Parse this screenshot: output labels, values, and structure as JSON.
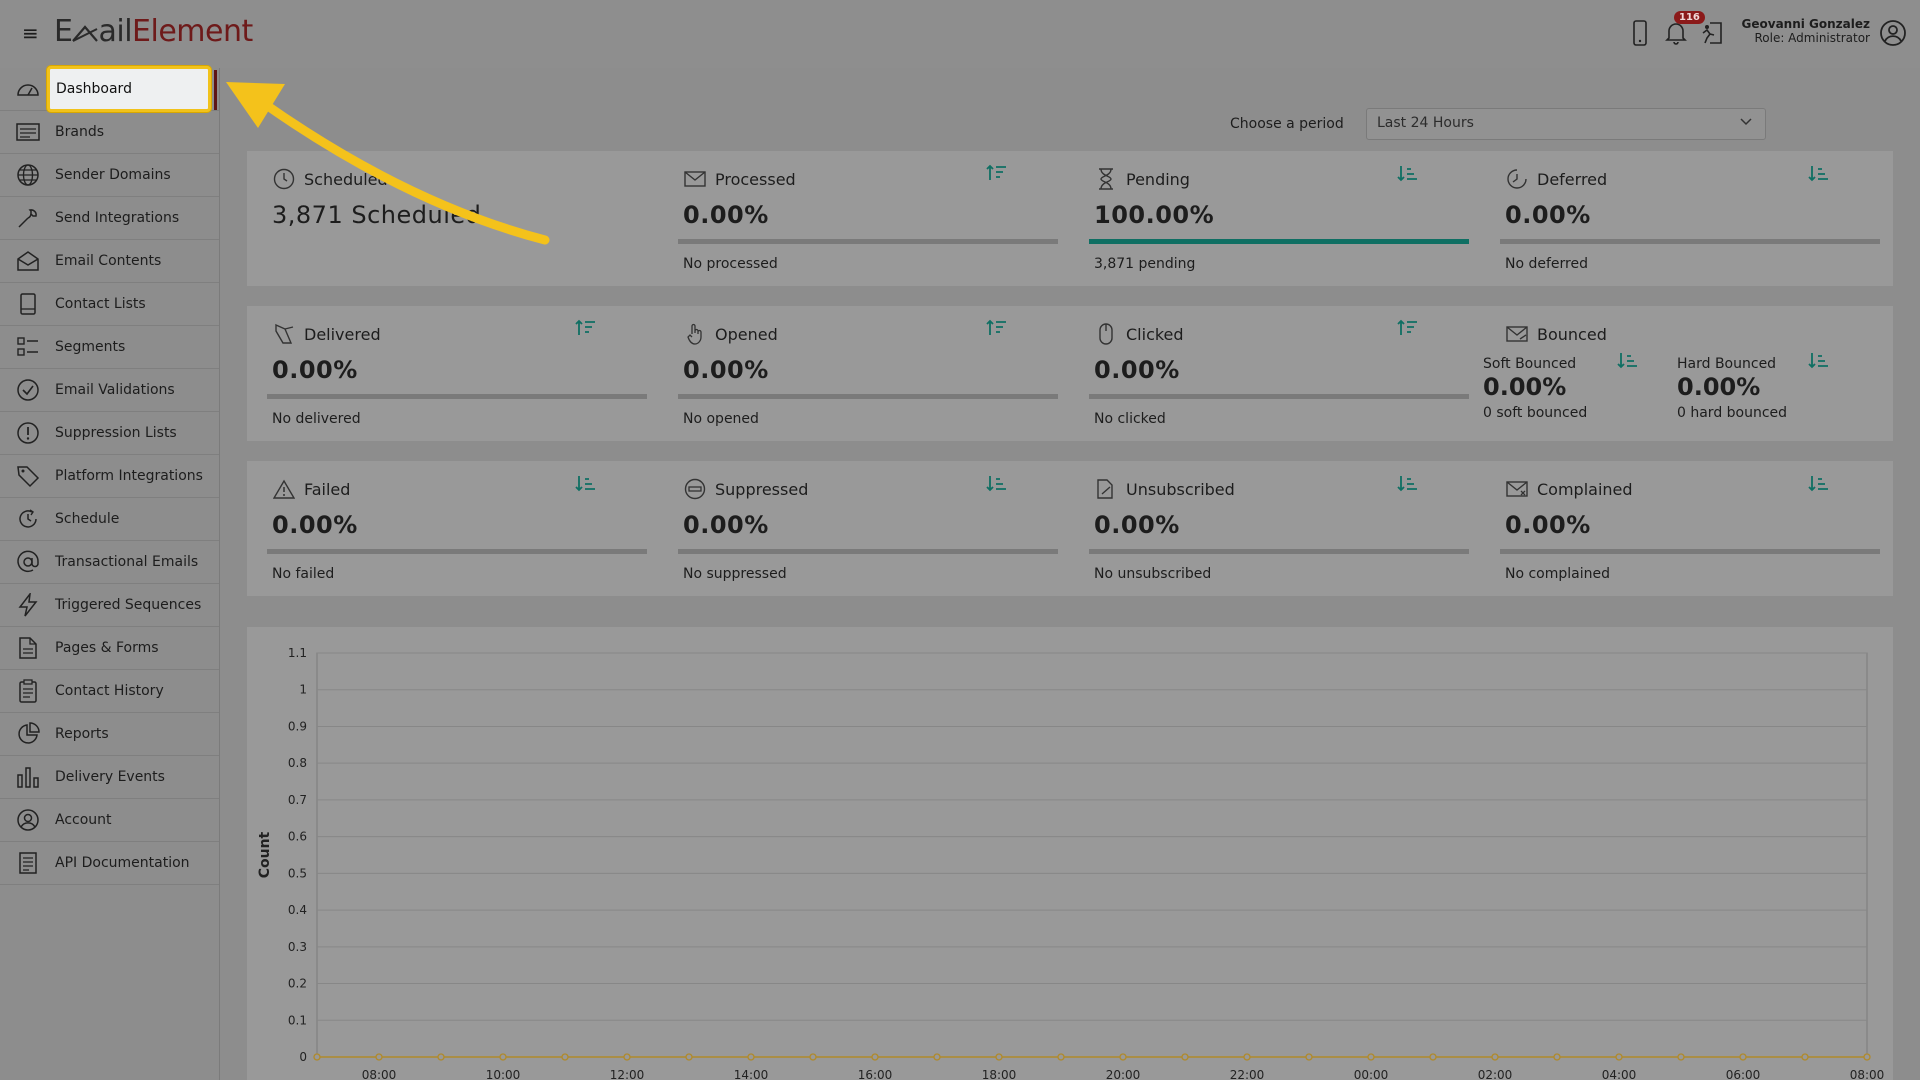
{
  "header": {
    "logo_part1": "E",
    "logo_part2": "ail",
    "logo_part3": "Element",
    "notification_count": "116",
    "user_name": "Geovanni Gonzalez",
    "user_role": "Role: Administrator"
  },
  "sidebar": {
    "items": [
      {
        "label": "Dashboard",
        "icon": "gauge-icon",
        "active": true
      },
      {
        "label": "Brands",
        "icon": "brands-icon"
      },
      {
        "label": "Sender Domains",
        "icon": "globe-icon"
      },
      {
        "label": "Send Integrations",
        "icon": "wrench-icon"
      },
      {
        "label": "Email Contents",
        "icon": "envelope-open-icon"
      },
      {
        "label": "Contact Lists",
        "icon": "book-icon"
      },
      {
        "label": "Segments",
        "icon": "segments-icon"
      },
      {
        "label": "Email Validations",
        "icon": "check-circle-icon"
      },
      {
        "label": "Suppression Lists",
        "icon": "exclamation-circle-icon"
      },
      {
        "label": "Platform Integrations",
        "icon": "tag-icon"
      },
      {
        "label": "Schedule",
        "icon": "clock-arrow-icon"
      },
      {
        "label": "Transactional Emails",
        "icon": "at-icon"
      },
      {
        "label": "Triggered Sequences",
        "icon": "lightning-icon"
      },
      {
        "label": "Pages & Forms",
        "icon": "file-icon"
      },
      {
        "label": "Contact History",
        "icon": "clipboard-icon"
      },
      {
        "label": "Reports",
        "icon": "pie-chart-icon"
      },
      {
        "label": "Delivery Events",
        "icon": "bar-chart-icon"
      },
      {
        "label": "Account",
        "icon": "user-circle-icon"
      },
      {
        "label": "API Documentation",
        "icon": "document-icon"
      }
    ]
  },
  "period": {
    "label": "Choose a period",
    "selected": "Last 24 Hours"
  },
  "cards": {
    "scheduled": {
      "title": "Scheduled",
      "value": "3,871 Scheduled"
    },
    "processed": {
      "title": "Processed",
      "value": "0.00%",
      "sub": "No processed",
      "fill": 0
    },
    "pending": {
      "title": "Pending",
      "value": "100.00%",
      "sub": "3,871 pending",
      "fill": 1.0
    },
    "deferred": {
      "title": "Deferred",
      "value": "0.00%",
      "sub": "No deferred",
      "fill": 0
    },
    "delivered": {
      "title": "Delivered",
      "value": "0.00%",
      "sub": "No delivered",
      "fill": 0
    },
    "opened": {
      "title": "Opened",
      "value": "0.00%",
      "sub": "No opened",
      "fill": 0
    },
    "clicked": {
      "title": "Clicked",
      "value": "0.00%",
      "sub": "No clicked",
      "fill": 0
    },
    "bounced": {
      "title": "Bounced",
      "soft_label": "Soft Bounced",
      "soft_value": "0.00%",
      "soft_sub": "0 soft bounced",
      "hard_label": "Hard Bounced",
      "hard_value": "0.00%",
      "hard_sub": "0 hard bounced"
    },
    "failed": {
      "title": "Failed",
      "value": "0.00%",
      "sub": "No failed",
      "fill": 0
    },
    "suppressed": {
      "title": "Suppressed",
      "value": "0.00%",
      "sub": "No suppressed",
      "fill": 0
    },
    "unsubscribed": {
      "title": "Unsubscribed",
      "value": "0.00%",
      "sub": "No unsubscribed",
      "fill": 0
    },
    "complained": {
      "title": "Complained",
      "value": "0.00%",
      "sub": "No complained",
      "fill": 0
    }
  },
  "colors": {
    "accent": "#0f6f63",
    "brand": "#6e1a1a",
    "highlight": "#f1c21b",
    "series": "#b08a2a"
  },
  "chart_data": {
    "type": "line",
    "ylabel": "Count",
    "ylim": [
      0,
      1.1
    ],
    "yticks": [
      "0",
      "0.1",
      "0.2",
      "0.3",
      "0.4",
      "0.5",
      "0.6",
      "0.7",
      "0.8",
      "0.9",
      "1",
      "1.1"
    ],
    "xtick_labels": [
      "08:00",
      "10:00",
      "12:00",
      "14:00",
      "16:00",
      "18:00",
      "20:00",
      "22:00",
      "00:00",
      "02:00",
      "04:00",
      "06:00",
      "08:00"
    ],
    "series": [
      {
        "values": [
          0,
          0,
          0,
          0,
          0,
          0,
          0,
          0,
          0,
          0,
          0,
          0,
          0,
          0,
          0,
          0,
          0,
          0,
          0,
          0,
          0,
          0,
          0,
          0,
          0,
          0
        ]
      }
    ]
  }
}
